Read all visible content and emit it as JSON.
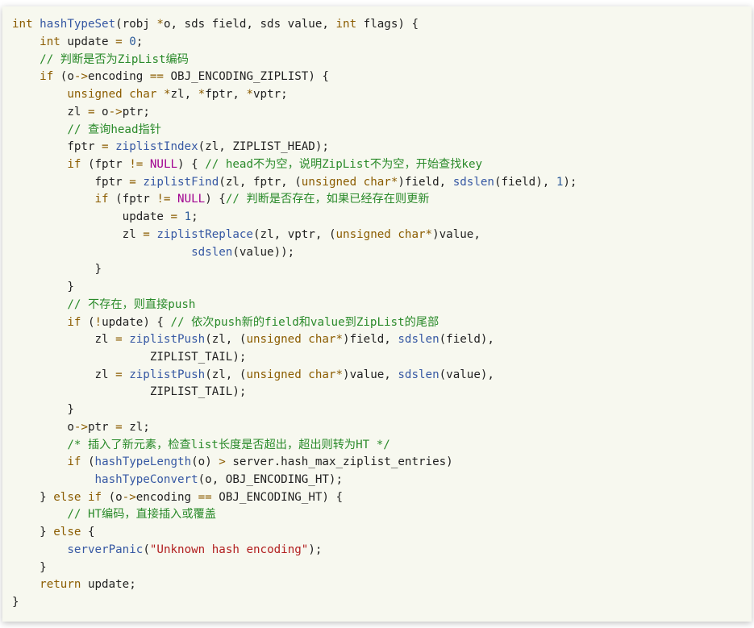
{
  "code": {
    "t": [
      {
        "kw": "int "
      },
      {
        "fn": "hashTypeSet"
      },
      {
        "p": "(robj "
      },
      {
        "op": "*"
      },
      {
        "p": "o, sds field, sds value, "
      },
      {
        "kw": "int"
      },
      {
        "p": " flags) {\n"
      },
      {
        "p": "    "
      },
      {
        "kw": "int"
      },
      {
        "p": " update "
      },
      {
        "op": "="
      },
      {
        "p": " "
      },
      {
        "num": "0"
      },
      {
        "p": ";\n"
      },
      {
        "p": "    "
      },
      {
        "cmt": "// 判断是否为ZipList编码"
      },
      {
        "p": "\n"
      },
      {
        "p": "    "
      },
      {
        "kw": "if"
      },
      {
        "p": " (o"
      },
      {
        "op": "->"
      },
      {
        "p": "encoding "
      },
      {
        "op": "=="
      },
      {
        "p": " "
      },
      {
        "mac": "OBJ_ENCODING_ZIPLIST"
      },
      {
        "p": ") {\n"
      },
      {
        "p": "        "
      },
      {
        "kw": "unsigned char "
      },
      {
        "op": "*"
      },
      {
        "p": "zl, "
      },
      {
        "op": "*"
      },
      {
        "p": "fptr, "
      },
      {
        "op": "*"
      },
      {
        "p": "vptr;\n"
      },
      {
        "p": "        zl "
      },
      {
        "op": "="
      },
      {
        "p": " o"
      },
      {
        "op": "->"
      },
      {
        "p": "ptr;\n"
      },
      {
        "p": "        "
      },
      {
        "cmt": "// 查询head指针"
      },
      {
        "p": "\n"
      },
      {
        "p": "        fptr "
      },
      {
        "op": "="
      },
      {
        "p": " "
      },
      {
        "fn": "ziplistIndex"
      },
      {
        "p": "(zl, ZIPLIST_HEAD);\n"
      },
      {
        "p": "        "
      },
      {
        "kw": "if"
      },
      {
        "p": " (fptr "
      },
      {
        "op": "!="
      },
      {
        "p": " "
      },
      {
        "nul": "NULL"
      },
      {
        "p": ") { "
      },
      {
        "cmt": "// head不为空，说明ZipList不为空，开始查找key"
      },
      {
        "p": "\n"
      },
      {
        "p": "            fptr "
      },
      {
        "op": "="
      },
      {
        "p": " "
      },
      {
        "fn": "ziplistFind"
      },
      {
        "p": "(zl, fptr, ("
      },
      {
        "kw": "unsigned char"
      },
      {
        "op": "*"
      },
      {
        "p": ")field, "
      },
      {
        "fn": "sdslen"
      },
      {
        "p": "(field), "
      },
      {
        "num": "1"
      },
      {
        "p": ");\n"
      },
      {
        "p": "            "
      },
      {
        "kw": "if"
      },
      {
        "p": " (fptr "
      },
      {
        "op": "!="
      },
      {
        "p": " "
      },
      {
        "nul": "NULL"
      },
      {
        "p": ") {"
      },
      {
        "cmt": "// 判断是否存在，如果已经存在则更新"
      },
      {
        "p": "\n"
      },
      {
        "p": "                update "
      },
      {
        "op": "="
      },
      {
        "p": " "
      },
      {
        "num": "1"
      },
      {
        "p": ";\n"
      },
      {
        "p": "                zl "
      },
      {
        "op": "="
      },
      {
        "p": " "
      },
      {
        "fn": "ziplistReplace"
      },
      {
        "p": "(zl, vptr, ("
      },
      {
        "kw": "unsigned char"
      },
      {
        "op": "*"
      },
      {
        "p": ")value,\n"
      },
      {
        "p": "                          "
      },
      {
        "fn": "sdslen"
      },
      {
        "p": "(value));\n"
      },
      {
        "p": "            }\n"
      },
      {
        "p": "        }\n"
      },
      {
        "p": "        "
      },
      {
        "cmt": "// 不存在，则直接push"
      },
      {
        "p": "\n"
      },
      {
        "p": "        "
      },
      {
        "kw": "if"
      },
      {
        "p": " ("
      },
      {
        "op": "!"
      },
      {
        "p": "update) { "
      },
      {
        "cmt": "// 依次push新的field和value到ZipList的尾部"
      },
      {
        "p": "\n"
      },
      {
        "p": "            zl "
      },
      {
        "op": "="
      },
      {
        "p": " "
      },
      {
        "fn": "ziplistPush"
      },
      {
        "p": "(zl, ("
      },
      {
        "kw": "unsigned char"
      },
      {
        "op": "*"
      },
      {
        "p": ")field, "
      },
      {
        "fn": "sdslen"
      },
      {
        "p": "(field),\n"
      },
      {
        "p": "                    ZIPLIST_TAIL);\n"
      },
      {
        "p": "            zl "
      },
      {
        "op": "="
      },
      {
        "p": " "
      },
      {
        "fn": "ziplistPush"
      },
      {
        "p": "(zl, ("
      },
      {
        "kw": "unsigned char"
      },
      {
        "op": "*"
      },
      {
        "p": ")value, "
      },
      {
        "fn": "sdslen"
      },
      {
        "p": "(value),\n"
      },
      {
        "p": "                    ZIPLIST_TAIL);\n"
      },
      {
        "p": "        }\n"
      },
      {
        "p": "        o"
      },
      {
        "op": "->"
      },
      {
        "p": "ptr "
      },
      {
        "op": "="
      },
      {
        "p": " zl;\n"
      },
      {
        "p": "        "
      },
      {
        "cmt": "/* 插入了新元素，检查list长度是否超出，超出则转为HT */"
      },
      {
        "p": "\n"
      },
      {
        "p": "        "
      },
      {
        "kw": "if"
      },
      {
        "p": " ("
      },
      {
        "fn": "hashTypeLength"
      },
      {
        "p": "(o) "
      },
      {
        "op": ">"
      },
      {
        "p": " server.hash_max_ziplist_entries)\n"
      },
      {
        "p": "            "
      },
      {
        "fn": "hashTypeConvert"
      },
      {
        "p": "(o, OBJ_ENCODING_HT);\n"
      },
      {
        "p": "    } "
      },
      {
        "kw": "else if"
      },
      {
        "p": " (o"
      },
      {
        "op": "->"
      },
      {
        "p": "encoding "
      },
      {
        "op": "=="
      },
      {
        "p": " "
      },
      {
        "mac": "OBJ_ENCODING_HT"
      },
      {
        "p": ") {\n"
      },
      {
        "p": "        "
      },
      {
        "cmt": "// HT编码，直接插入或覆盖"
      },
      {
        "p": "\n"
      },
      {
        "p": "    } "
      },
      {
        "kw": "else"
      },
      {
        "p": " {\n"
      },
      {
        "p": "        "
      },
      {
        "fn": "serverPanic"
      },
      {
        "p": "("
      },
      {
        "str": "\"Unknown hash encoding\""
      },
      {
        "p": ");\n"
      },
      {
        "p": "    }\n"
      },
      {
        "p": "    "
      },
      {
        "kw": "return"
      },
      {
        "p": " update;\n"
      },
      {
        "p": "}"
      }
    ]
  }
}
